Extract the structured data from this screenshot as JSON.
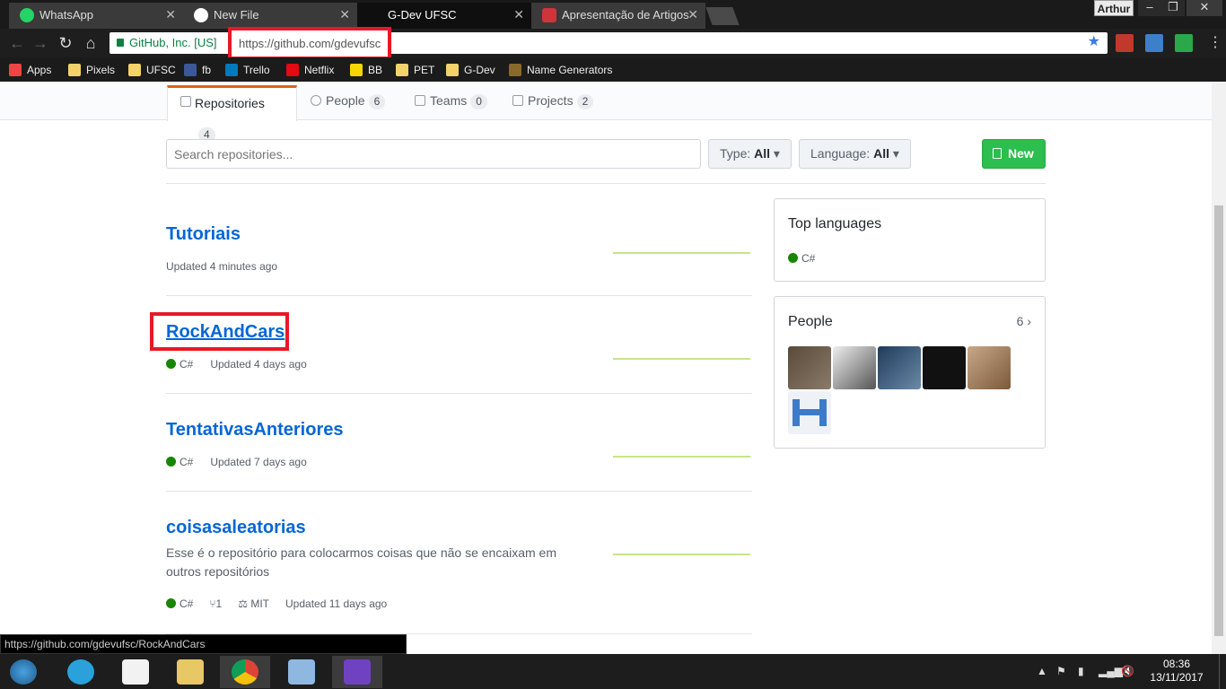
{
  "browser": {
    "tabs": [
      {
        "title": "WhatsApp",
        "icon": "whatsapp-icon",
        "color": "#25d366"
      },
      {
        "title": "New File",
        "icon": "github-icon",
        "color": "#ffffff"
      },
      {
        "title": "G-Dev UFSC",
        "icon": "",
        "color": ""
      },
      {
        "title": "Apresentação de Artigos",
        "icon": "trello-icon",
        "color": "#d0343b"
      }
    ],
    "profile": "Arthur",
    "secure_label": "GitHub, Inc. [US]",
    "url_scheme": "https://",
    "url_rest": "github.com/gdevufsc",
    "bookmarks": [
      "Apps",
      "Pixels",
      "UFSC",
      "fb",
      "Trello",
      "Netflix",
      "BB",
      "PET",
      "G-Dev",
      "Name Generators"
    ]
  },
  "org_nav": {
    "tabs": [
      {
        "label": "Repositories",
        "count": "4"
      },
      {
        "label": "People",
        "count": "6"
      },
      {
        "label": "Teams",
        "count": "0"
      },
      {
        "label": "Projects",
        "count": "2"
      }
    ]
  },
  "filters": {
    "search_placeholder": "Search repositories...",
    "type_label": "Type:",
    "type_value": "All",
    "language_label": "Language:",
    "language_value": "All",
    "new_label": "New"
  },
  "repos": [
    {
      "name": "Tutoriais",
      "lang": "",
      "updated": "Updated 4 minutes ago"
    },
    {
      "name": "RockAndCars",
      "lang": "C#",
      "updated": "Updated 4 days ago"
    },
    {
      "name": "TentativasAnteriores",
      "lang": "C#",
      "updated": "Updated 7 days ago"
    },
    {
      "name": "coisasaleatorias",
      "description": "Esse é o repositório para colocarmos coisas que não se encaixam em outros repositórios",
      "lang": "C#",
      "forks": "1",
      "license": "MIT",
      "updated": "Updated 11 days ago"
    }
  ],
  "sidebar": {
    "top_languages_title": "Top languages",
    "top_language": "C#",
    "people_title": "People",
    "people_count": "6"
  },
  "status_bar_url": "https://github.com/gdevufsc/RockAndCars",
  "taskbar": {
    "time": "08:36",
    "date": "13/11/2017"
  },
  "colors": {
    "csharp": "#178600",
    "link": "#0366d6",
    "highlight": "#e81828",
    "new_button": "#2cbe4e"
  }
}
